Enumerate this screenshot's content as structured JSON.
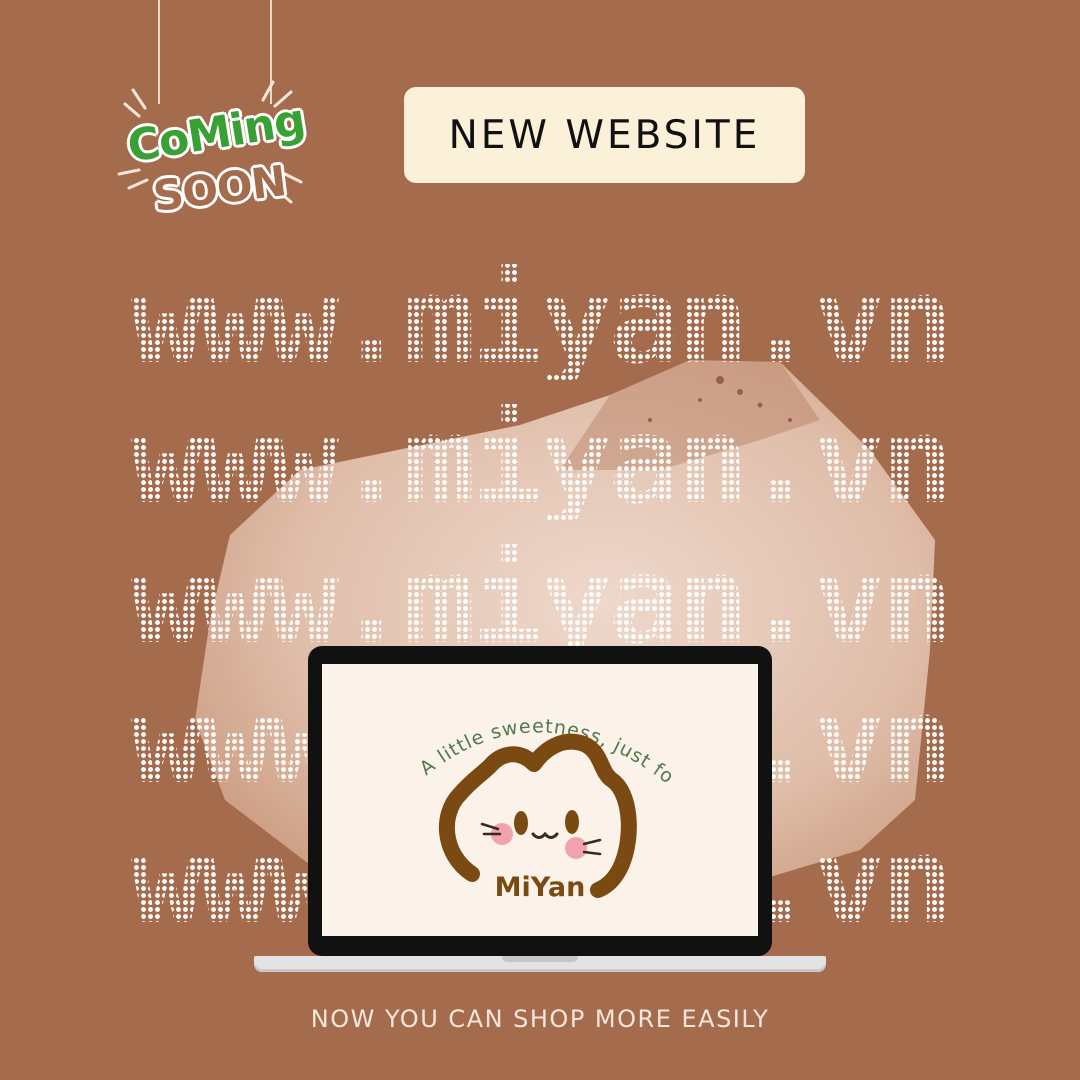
{
  "badge": {
    "line1": "CoMing",
    "line2": "SOON"
  },
  "header": {
    "label": "NEW WEBSITE"
  },
  "url": {
    "lines": [
      "www.miyan.vn",
      "www.miyan.vn",
      "www.miyan.vn",
      "www.miyan.vn",
      "www.miyan.vn"
    ]
  },
  "laptop": {
    "tagline": "A little sweetness, just for you",
    "brand": "MiYan"
  },
  "footer": {
    "text": "NOW YOU CAN SHOP MORE EASILY"
  },
  "colors": {
    "background": "#a56b4d",
    "badge_green": "#39a035",
    "label_bg": "#fbf1d8",
    "brand_brown": "#7a4a12",
    "tagline_green": "#4e7a4c"
  }
}
